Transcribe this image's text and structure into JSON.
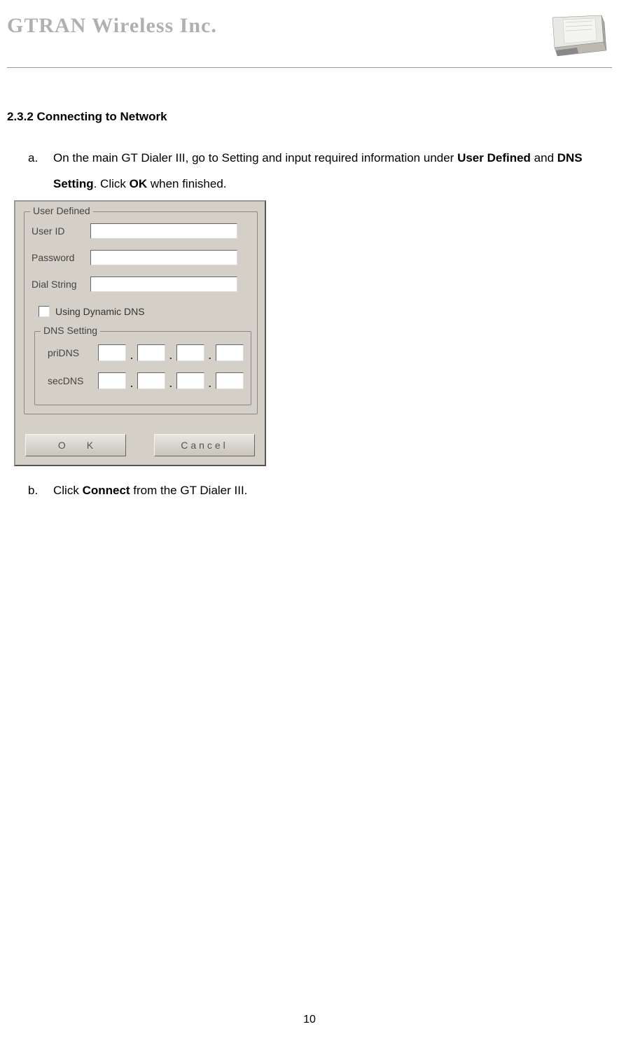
{
  "header": {
    "company": "GTRAN Wireless Inc."
  },
  "section": {
    "heading": "2.3.2 Connecting to Network",
    "step_a_marker": "a.",
    "step_a_pre": "On the main GT Dialer III, go to Setting and input required information under ",
    "step_a_bold1": "User Defined",
    "step_a_mid1": " and ",
    "step_a_bold2": "DNS Setting",
    "step_a_mid2": ". Click ",
    "step_a_bold3": "OK",
    "step_a_end": " when finished.",
    "step_b_marker": "b.",
    "step_b_pre": "Click ",
    "step_b_bold": "Connect",
    "step_b_end": " from the GT Dialer III."
  },
  "dialog": {
    "user_defined_legend": "User Defined",
    "user_id_label": "User ID",
    "password_label": "Password",
    "dial_string_label": "Dial String",
    "dynamic_dns_label": "Using Dynamic DNS",
    "dns_setting_legend": "DNS Setting",
    "pridns_label": "priDNS",
    "secdns_label": "secDNS",
    "ok_label": "OK",
    "cancel_label": "Cancel"
  },
  "footer": {
    "page_number": "10"
  }
}
